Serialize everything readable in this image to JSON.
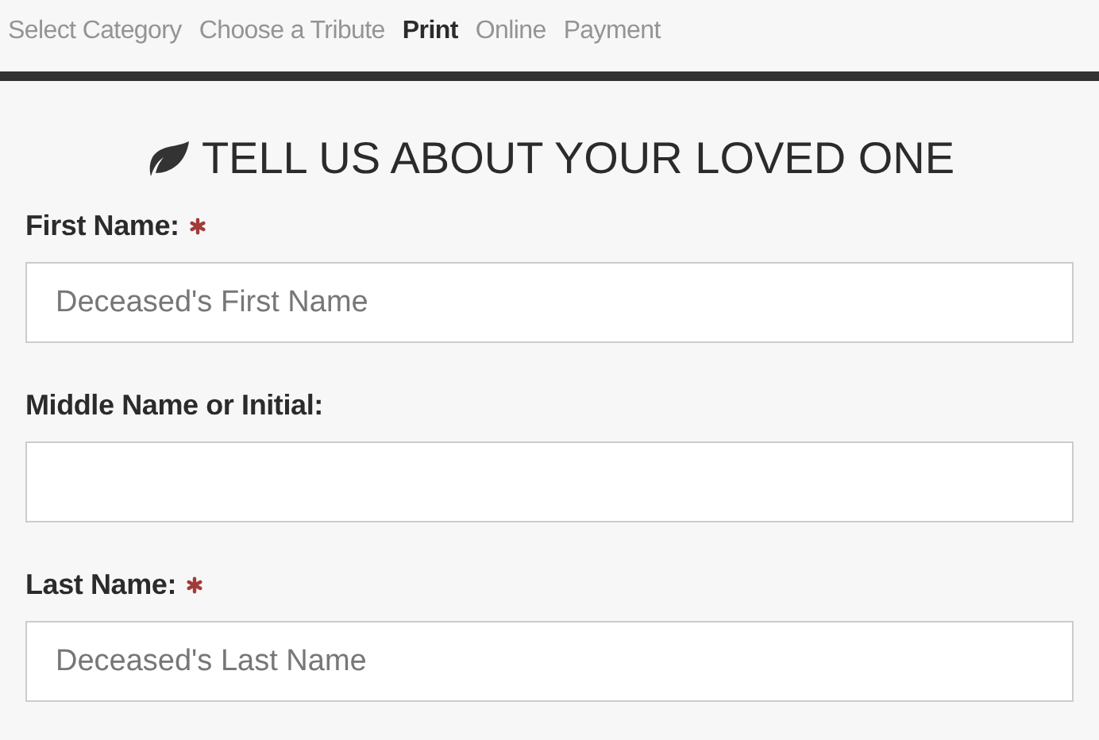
{
  "steps": [
    {
      "label": "Select Category",
      "selected": false
    },
    {
      "label": "Choose a Tribute",
      "selected": false
    },
    {
      "label": "Print",
      "selected": true
    },
    {
      "label": "Online",
      "selected": false
    },
    {
      "label": "Payment",
      "selected": false
    }
  ],
  "heading": "TELL US ABOUT YOUR LOVED ONE",
  "fields": [
    {
      "label": "First Name:",
      "required": true,
      "placeholder": "Deceased's First Name"
    },
    {
      "label": "Middle Name or Initial:",
      "required": false
    },
    {
      "label": "Last Name:",
      "required": true,
      "placeholder": "Deceased's Last Name"
    }
  ]
}
